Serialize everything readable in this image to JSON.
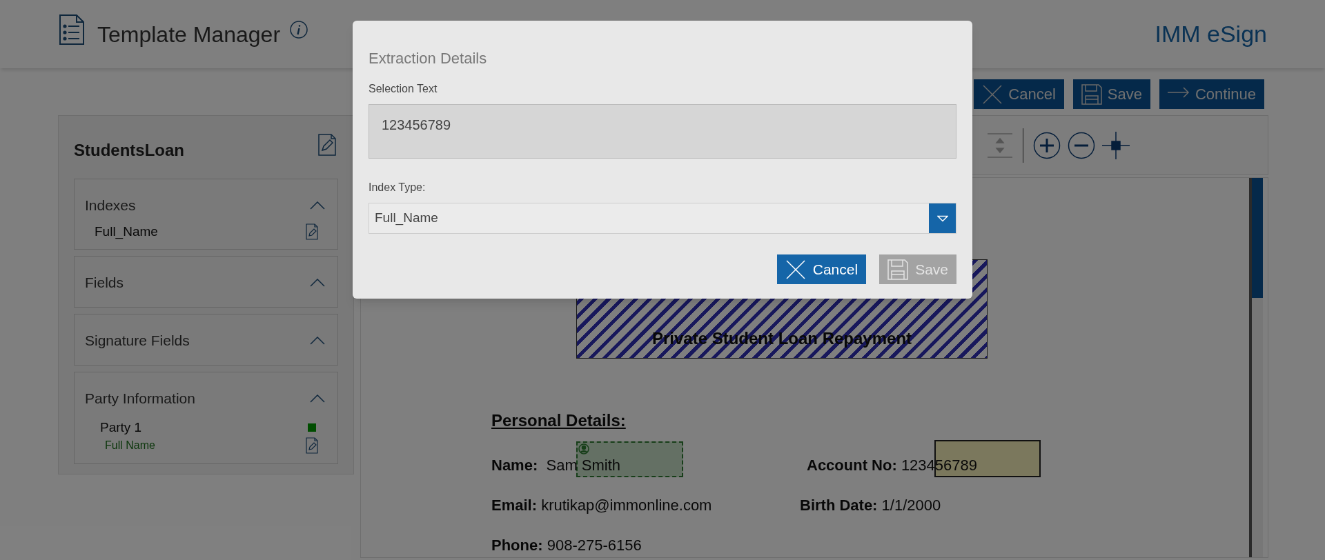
{
  "header": {
    "title": "Template Manager",
    "brand": "IMM eSign"
  },
  "actions": [
    {
      "label": "Cancel",
      "kind": "cancel"
    },
    {
      "label": "Save",
      "kind": "save"
    },
    {
      "label": "Continue",
      "kind": "continue"
    }
  ],
  "template": {
    "name": "StudentsLoan",
    "sections": [
      {
        "title": "Indexes",
        "expanded": true,
        "items": [
          {
            "label": "Full_Name",
            "kind": "index"
          }
        ]
      },
      {
        "title": "Fields",
        "expanded": true
      },
      {
        "title": "Signature Fields",
        "expanded": true
      },
      {
        "title": "Party Information",
        "expanded": true,
        "items": [
          {
            "label": "Party 1",
            "kind": "party",
            "color": "#004d00"
          },
          {
            "label": "Full Name",
            "kind": "party-field"
          }
        ]
      }
    ]
  },
  "document": {
    "heading": "Private Student Loan Repayment",
    "section_title": "Personal Details:",
    "rows": [
      [
        {
          "label": "Name:",
          "value": "Sam Smith"
        },
        {
          "label": "Account No:",
          "value": "123456789"
        }
      ],
      [
        {
          "label": "Email:",
          "value": "krutikap@immonline.com"
        },
        {
          "label": "Birth Date:",
          "value": "1/1/2000"
        }
      ],
      [
        {
          "label": "Phone:",
          "value": "908-275-6156"
        }
      ]
    ]
  },
  "dialog": {
    "title": "Extraction Details",
    "selection_label": "Selection Text",
    "selection_value": "123456789",
    "index_type_label": "Index Type:",
    "index_type_value": "Full_Name",
    "buttons": [
      {
        "label": "Cancel",
        "kind": "cancel",
        "disabled": false
      },
      {
        "label": "Save",
        "kind": "save",
        "disabled": true
      }
    ]
  }
}
